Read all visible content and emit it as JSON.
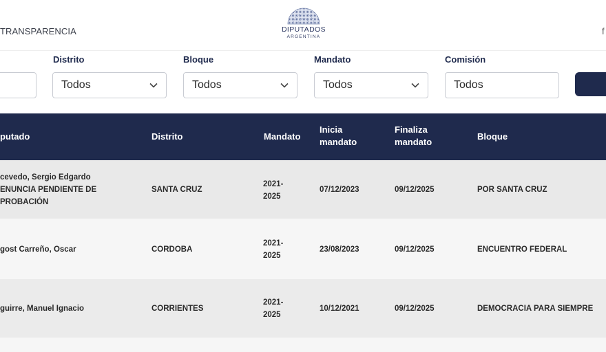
{
  "header": {
    "nav_link": "TRANSPARENCIA",
    "logo_title": "DIPUTADOS",
    "logo_subtitle": "ARGENTINA",
    "edge_glyph": "f"
  },
  "filters": {
    "search_value": "",
    "distrito": {
      "label": "Distrito",
      "value": "Todos"
    },
    "bloque": {
      "label": "Bloque",
      "value": "Todos"
    },
    "mandato": {
      "label": "Mandato",
      "value": "Todos"
    },
    "comision": {
      "label": "Comisión",
      "value": "Todos"
    }
  },
  "table": {
    "headers": {
      "diputado": "putado",
      "distrito": "Distrito",
      "mandato": "Mandato",
      "inicia_1": "Inicia",
      "inicia_2": "mandato",
      "finaliza_1": "Finaliza",
      "finaliza_2": "mandato",
      "bloque": "Bloque"
    },
    "rows": [
      {
        "name_1": "cevedo, Sergio Edgardo",
        "name_2": "ENUNCIA PENDIENTE DE",
        "name_3": "PROBACIÓN",
        "distrito": "SANTA CRUZ",
        "mandato_1": "2021-",
        "mandato_2": "2025",
        "inicia": "07/12/2023",
        "finaliza": "09/12/2025",
        "bloque": "POR SANTA CRUZ"
      },
      {
        "name_1": "gost Carreño, Oscar",
        "distrito": "CORDOBA",
        "mandato_1": "2021-",
        "mandato_2": "2025",
        "inicia": "23/08/2023",
        "finaliza": "09/12/2025",
        "bloque": "ENCUENTRO FEDERAL"
      },
      {
        "name_1": "guirre, Manuel Ignacio",
        "distrito": "CORRIENTES",
        "mandato_1": "2021-",
        "mandato_2": "2025",
        "inicia": "10/12/2021",
        "finaliza": "09/12/2025",
        "bloque": "DEMOCRACIA PARA SIEMPRE"
      }
    ]
  },
  "colors": {
    "navy": "#1f2a4d",
    "row_dark": "#e9e9e9",
    "row_light": "#f6f6f6"
  }
}
